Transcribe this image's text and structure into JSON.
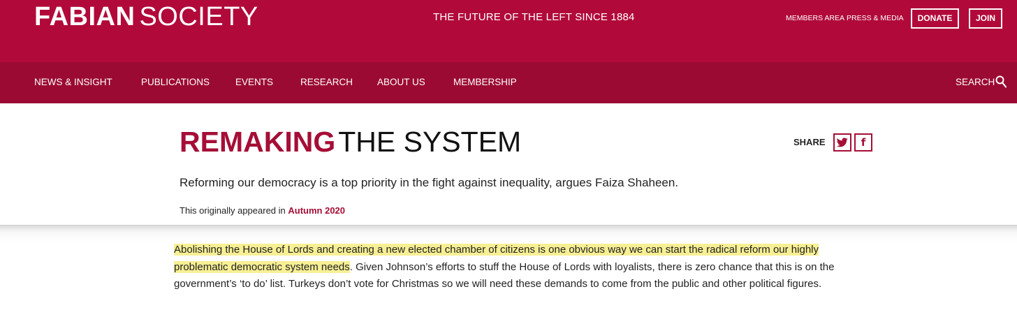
{
  "header": {
    "logo_bold": "FABIAN",
    "logo_light": "SOCIETY",
    "tagline": "THE FUTURE OF THE LEFT SINCE 1884",
    "members_area": "MEMBERS AREA",
    "press_media": "PRESS & MEDIA",
    "donate": "DONATE",
    "join": "JOIN"
  },
  "nav": {
    "items": [
      {
        "label": "NEWS & INSIGHT"
      },
      {
        "label": "PUBLICATIONS"
      },
      {
        "label": "EVENTS"
      },
      {
        "label": "RESEARCH"
      },
      {
        "label": "ABOUT US"
      },
      {
        "label": "MEMBERSHIP"
      }
    ],
    "search_label": "SEARCH"
  },
  "article": {
    "title_accent": "REMAKING",
    "title_rest": "THE SYSTEM",
    "share_label": "SHARE",
    "standfirst": "Reforming our democracy is a top priority in the fight against inequality, argues Faiza Shaheen.",
    "origin_prefix": "This originally appeared in",
    "origin_link": "Autumn 2020",
    "body_highlight": "Abolishing the House of Lords and creating a new elected chamber of citizens is one obvious way we can start the radical reform our highly problematic democratic system needs",
    "body_rest": ". Given Johnson’s efforts to stuff the House of Lords with loyalists, there is zero chance that this is on the government’s ‘to do’ list. Turkeys don’t vote for Christmas so we will need these demands to come from the public and other political figures."
  },
  "colors": {
    "brand_primary": "#b10a3a",
    "brand_dark": "#9b0a32",
    "accent": "#a50e36",
    "highlight": "#f7ef94"
  },
  "icons": {
    "search": "search-icon",
    "twitter": "twitter-icon",
    "facebook": "facebook-icon"
  }
}
